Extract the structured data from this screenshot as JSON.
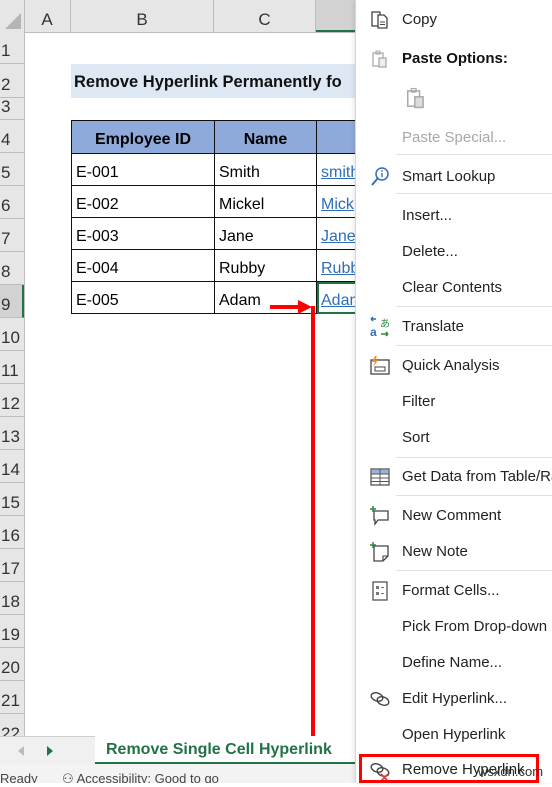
{
  "spreadsheet": {
    "columns": [
      "A",
      "B",
      "C",
      ""
    ],
    "rows": [
      "1",
      "2",
      "3",
      "4",
      "5",
      "6",
      "7",
      "8",
      "9",
      "10",
      "11",
      "12",
      "13",
      "14",
      "15",
      "16",
      "17",
      "18",
      "19",
      "20",
      "21",
      "22"
    ],
    "selected_row": "9",
    "title": "Remove Hyperlink Permanently fo",
    "table": {
      "headers": [
        "Employee ID",
        "Name",
        ""
      ],
      "rows": [
        {
          "id": "E-001",
          "name": "Smith",
          "link": "smith"
        },
        {
          "id": "E-002",
          "name": "Mickel",
          "link": "Mick"
        },
        {
          "id": "E-003",
          "name": "Jane",
          "link": "Jane"
        },
        {
          "id": "E-004",
          "name": "Rubby",
          "link": "Rubb"
        },
        {
          "id": "E-005",
          "name": "Adam",
          "link": "Adam"
        }
      ]
    }
  },
  "sheet_tabs": {
    "active": "Remove Single Cell Hyperlink"
  },
  "status_bar": {
    "ready": "Ready",
    "accessibility": "Accessibility: Good to go"
  },
  "context_menu": {
    "items": [
      {
        "label": "Copy",
        "icon": "copy-icon"
      },
      {
        "label": "Paste Options:",
        "icon": "paste-icon"
      },
      {
        "label": "",
        "icon": "paste-option-icon"
      },
      {
        "label": "Paste Special...",
        "icon": ""
      },
      {
        "label": "Smart Lookup",
        "icon": "smart-lookup-icon"
      },
      {
        "label": "Insert...",
        "icon": ""
      },
      {
        "label": "Delete...",
        "icon": ""
      },
      {
        "label": "Clear Contents",
        "icon": ""
      },
      {
        "label": "Translate",
        "icon": "translate-icon"
      },
      {
        "label": "Quick Analysis",
        "icon": "quick-analysis-icon"
      },
      {
        "label": "Filter",
        "icon": ""
      },
      {
        "label": "Sort",
        "icon": ""
      },
      {
        "label": "Get Data from Table/Range...",
        "icon": "table-icon"
      },
      {
        "label": "New Comment",
        "icon": "new-comment-icon"
      },
      {
        "label": "New Note",
        "icon": "new-note-icon"
      },
      {
        "label": "Format Cells...",
        "icon": "format-cells-icon"
      },
      {
        "label": "Pick From Drop-down List...",
        "icon": ""
      },
      {
        "label": "Define Name...",
        "icon": ""
      },
      {
        "label": "Edit Hyperlink...",
        "icon": "link-icon"
      },
      {
        "label": "Open Hyperlink",
        "icon": ""
      },
      {
        "label": "Remove Hyperlink",
        "icon": "remove-link-icon"
      }
    ]
  },
  "annotation": {
    "color": "#ff0000",
    "highlighted_item": "Remove Hyperlink"
  },
  "watermark": "wsxdn.com",
  "colors": {
    "excel_green": "#217346",
    "header_blue": "#8eaadb",
    "title_fill": "#dde8f4",
    "link": "#2f6eba"
  }
}
